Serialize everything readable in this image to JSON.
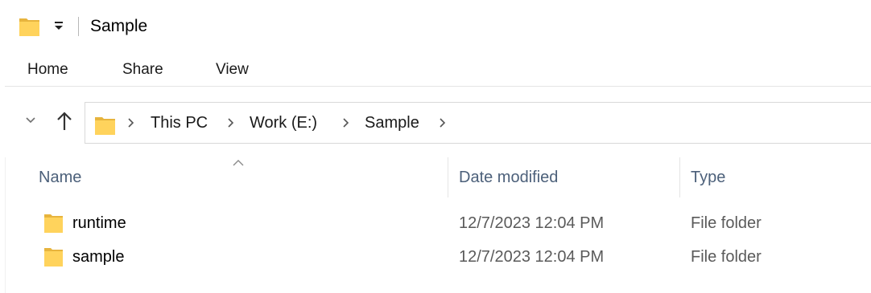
{
  "window": {
    "title": "Sample"
  },
  "ribbon": {
    "tabs": [
      "Home",
      "Share",
      "View"
    ]
  },
  "address": {
    "breadcrumbs": [
      "This PC",
      "Work (E:)",
      "Sample"
    ]
  },
  "columns": {
    "name": "Name",
    "date_modified": "Date modified",
    "type": "Type"
  },
  "sort": {
    "column": "Name",
    "direction": "ascending"
  },
  "files": [
    {
      "name": "runtime",
      "date_modified": "12/7/2023 12:04 PM",
      "type": "File folder"
    },
    {
      "name": "sample",
      "date_modified": "12/7/2023 12:04 PM",
      "type": "File folder"
    }
  ],
  "icons": {
    "folder": "folder-icon",
    "quick_access": "customize-quick-access-icon",
    "recent": "recent-locations-chevron-icon",
    "up": "up-arrow-icon",
    "breadcrumb_separator": "chevron-right-icon",
    "sort": "sort-ascending-caret-icon"
  },
  "colors": {
    "folder_fill": "#FFD35C",
    "folder_back": "#E7B43D",
    "column_header_text": "#4C607A",
    "secondary_text": "#5A5A5A",
    "divider": "#E5E5E5"
  }
}
